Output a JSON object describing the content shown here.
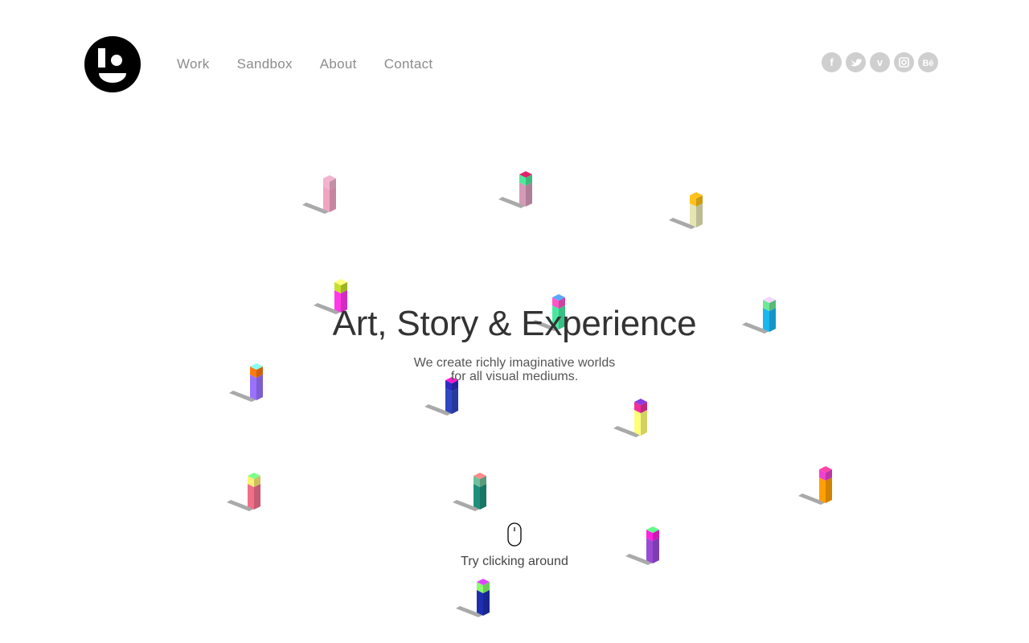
{
  "header": {
    "logo_icon": "studio-logo-icon",
    "nav": [
      {
        "label": "Work"
      },
      {
        "label": "Sandbox"
      },
      {
        "label": "About"
      },
      {
        "label": "Contact"
      }
    ],
    "social": [
      {
        "name": "facebook-icon",
        "glyph": "f"
      },
      {
        "name": "twitter-icon",
        "glyph": ""
      },
      {
        "name": "vimeo-icon",
        "glyph": "v"
      },
      {
        "name": "instagram-icon",
        "glyph": ""
      },
      {
        "name": "behance-icon",
        "glyph": "Bē"
      }
    ]
  },
  "hero": {
    "title": "Art, Story & Experience",
    "subtitle_line1": "We create richly imaginative worlds",
    "subtitle_line2": "for all visual mediums."
  },
  "hint": {
    "icon": "mouse-icon",
    "text": "Try clicking around"
  },
  "scene": {
    "pillars": [
      {
        "top": "#f3b3cc",
        "mid": "#f3b3cc",
        "body": "#f1a4c2"
      },
      {
        "top": "#e0226b",
        "mid": "#4eea9a",
        "body": "#d49ab8"
      },
      {
        "top": "#ffc21c",
        "mid": "#ffc21c",
        "body": "#e4e5b2"
      },
      {
        "top": "#ffff80",
        "mid": "#c6e02e",
        "body": "#ff38e8"
      },
      {
        "top": "#58a8ff",
        "mid": "#ff55c8",
        "body": "#46e8a0"
      },
      {
        "top": "#f4d6ff",
        "mid": "#6ee894",
        "body": "#1ab6f0"
      },
      {
        "top": "#88ffee",
        "mid": "#ff7a10",
        "body": "#9a72ff"
      },
      {
        "top": "#ff18d0",
        "mid": "#2b2ec0",
        "body": "#2f46c0"
      },
      {
        "top": "#8a3ae0",
        "mid": "#f02f9c",
        "body": "#ffff7a"
      },
      {
        "top": "#80ff88",
        "mid": "#fff078",
        "body": "#f06e88"
      },
      {
        "top": "#ff8a8a",
        "mid": "#6ec09a",
        "body": "#1f8f7a"
      },
      {
        "top": "#ff44aa",
        "mid": "#f040d0",
        "body": "#ffa000"
      },
      {
        "top": "#60ff88",
        "mid": "#ff22e0",
        "body": "#9a4ad6"
      },
      {
        "top": "#e044ff",
        "mid": "#8aff70",
        "body": "#1e2eb0"
      }
    ]
  }
}
